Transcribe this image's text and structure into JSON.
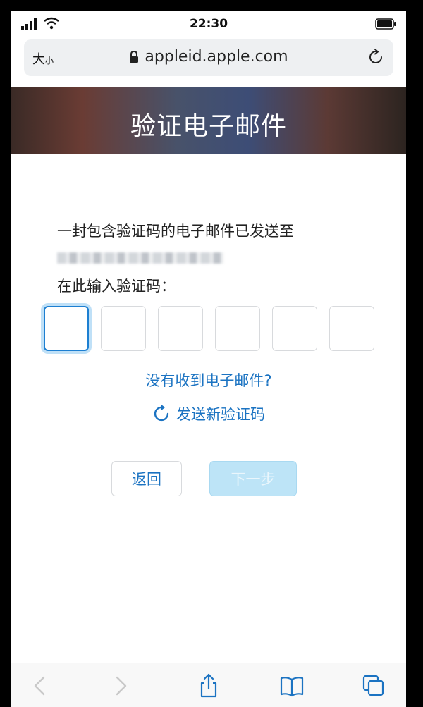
{
  "status_bar": {
    "time": "22:30",
    "icons": [
      "signal-icon",
      "wifi-icon",
      "battery-icon"
    ]
  },
  "browser": {
    "text_size_label": "大",
    "text_size_small": "小",
    "url": "appleid.apple.com",
    "icons": [
      "lock-icon",
      "reload-icon"
    ]
  },
  "header": {
    "title": "验证电子邮件"
  },
  "main": {
    "message": "一封包含验证码的电子邮件已发送至",
    "prompt": "在此输入验证码：",
    "code_length": 6,
    "no_email_link": "没有收到电子邮件?",
    "resend_link": "发送新验证码",
    "back_button": "返回",
    "next_button": "下一步"
  },
  "toolbar": {
    "icons": [
      "back-arrow-icon",
      "forward-arrow-icon",
      "share-icon",
      "bookmarks-icon",
      "tabs-icon"
    ]
  },
  "colors": {
    "accent": "#1b73c2",
    "focus": "#1d7fd1",
    "next_disabled": "#bde4f7"
  }
}
